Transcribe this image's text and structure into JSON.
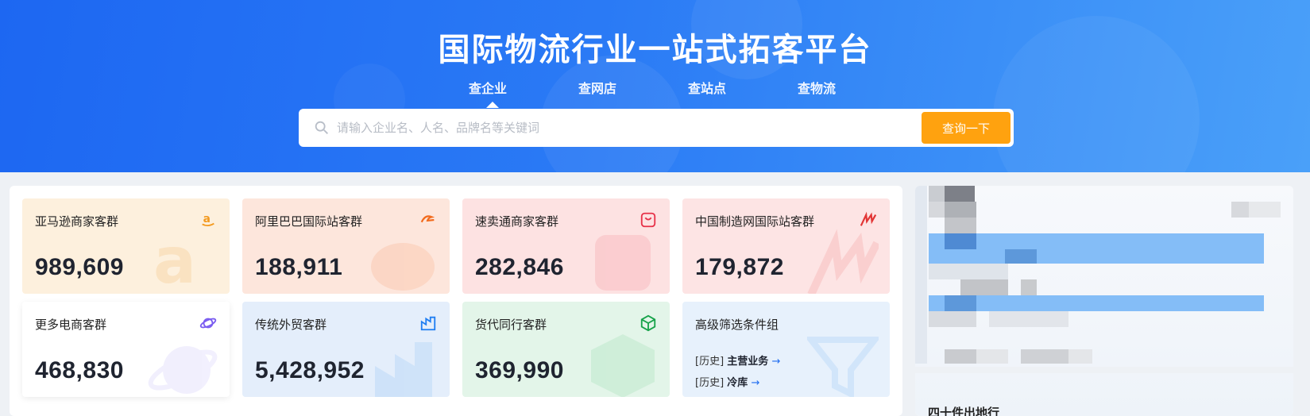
{
  "hero": {
    "title": "国际物流行业一站式拓客平台",
    "tabs": [
      "查企业",
      "查网店",
      "查站点",
      "查物流"
    ],
    "active_tab": "查企业"
  },
  "search": {
    "placeholder": "请输入企业名、人名、品牌名等关键词",
    "button": "查询一下"
  },
  "cards": [
    {
      "title": "亚马逊商家客群",
      "value": "989,609",
      "icon": "amazon-logo-icon",
      "color": "#fbecd9"
    },
    {
      "title": "阿里巴巴国际站客群",
      "value": "188,911",
      "icon": "alibaba-logo-icon",
      "color": "#fde4dc"
    },
    {
      "title": "速卖通商家客群",
      "value": "282,846",
      "icon": "aliexpress-bag-icon",
      "color": "#fde0e0"
    },
    {
      "title": "中国制造网国际站客群",
      "value": "179,872",
      "icon": "made-in-china-logo-icon",
      "color": "#fde2e2"
    },
    {
      "title": "更多电商客群",
      "value": "468,830",
      "icon": "planet-icon",
      "color": "#ffffff"
    },
    {
      "title": "传统外贸客群",
      "value": "5,428,952",
      "icon": "factory-icon",
      "color": "#e3effc"
    },
    {
      "title": "货代同行客群",
      "value": "369,990",
      "icon": "cube-box-icon",
      "color": "#e2f5e8"
    }
  ],
  "filter_card": {
    "title": "高级筛选条件组",
    "history_prefix": "[历史]",
    "items": [
      "主营业务",
      "冷库"
    ],
    "arrow": "→"
  },
  "sidebar": {
    "footer_text": "四十件出地行"
  },
  "colors": {
    "hero": "#2a7af5",
    "button": "#ffa20f",
    "accent": "#1e6cf0"
  }
}
